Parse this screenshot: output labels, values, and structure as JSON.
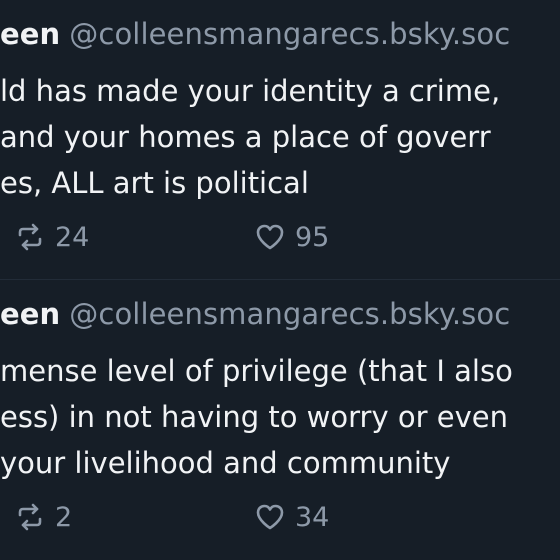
{
  "colors": {
    "background": "#161e27",
    "text_primary": "#f1f3f5",
    "text_secondary": "#8d99a8"
  },
  "posts": [
    {
      "display_name": "een",
      "handle": "@colleensmangarecs.bsky.soc",
      "body_lines": [
        "ld has made your identity a crime,",
        " and your homes a place of goverr",
        "es, ALL art is political"
      ],
      "repost_icon": "repost-icon",
      "repost_count": "24",
      "like_icon": "heart-icon",
      "like_count": "95"
    },
    {
      "display_name": "een",
      "handle": "@colleensmangarecs.bsky.soc",
      "body_lines": [
        "mense level of privilege (that I also",
        "ess) in not having to worry or even",
        "your livelihood and community"
      ],
      "repost_icon": "repost-icon",
      "repost_count": "2",
      "like_icon": "heart-icon",
      "like_count": "34"
    }
  ]
}
